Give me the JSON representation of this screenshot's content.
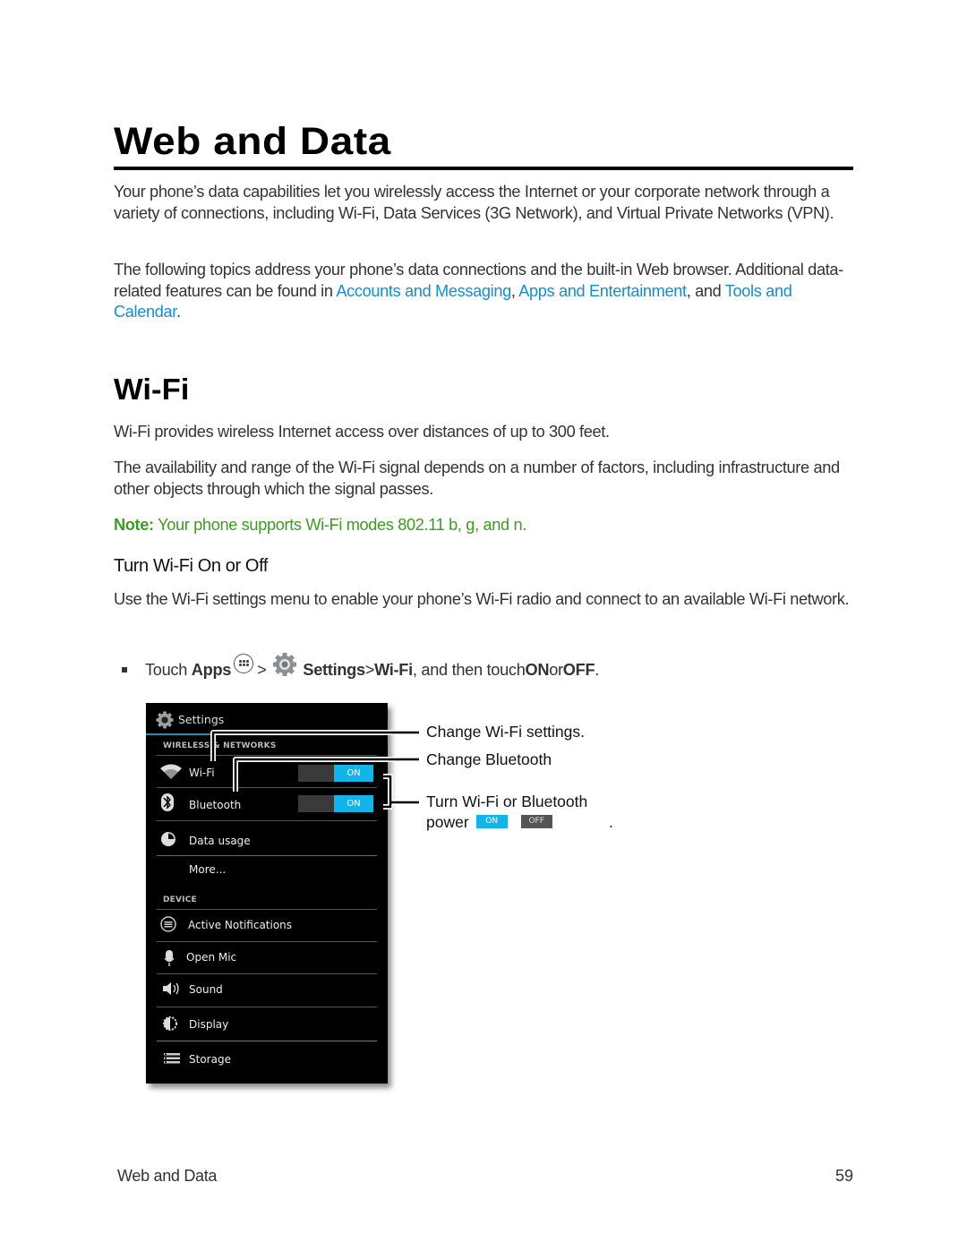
{
  "page": {
    "title": "Web and Data",
    "intro": "Your phone’s data capabilities let you wirelessly access the Internet or your corporate network through a variety of connections, including Wi-Fi, Data Services (3G Network), and Virtual Private Networks (VPN).",
    "topics": {
      "text_before": "The following topics address your phone’s data connections and the built-in Web browser. Additional data-related features can be found in ",
      "link1": "Accounts and Messaging",
      "sep1": ", ",
      "link2": "Apps and Entertainment",
      "sep2": ", and ",
      "link3": "Tools and Calendar",
      "end": "."
    }
  },
  "wifi": {
    "heading": "Wi-Fi",
    "p1": "Wi-Fi provides wireless Internet access over distances of up to 300 feet.",
    "p2": "The availability and range of the Wi-Fi signal depends on a number of factors, including infrastructure and other objects through which the signal passes.",
    "note_label": "Note:",
    "note_text": " Your phone supports Wi-Fi modes 802.11 b, g, and n.",
    "subheading": "Turn Wi-Fi On or Off",
    "p3": "Use the Wi-Fi settings menu to enable your phone’s Wi-Fi radio and connect to an available Wi-Fi network.",
    "colors": {
      "link": "#1b8cc4",
      "note": "#3d9a23",
      "toggle_on": "#12b4ea"
    }
  },
  "step": {
    "touch": "Touch ",
    "apps": "Apps",
    "gt1": " > ",
    "settings": "Settings",
    "gt2": " > ",
    "wifi": "Wi-Fi",
    "then": ", and then touch ",
    "on": "ON",
    "or": " or ",
    "off": "OFF",
    "end": "."
  },
  "phone": {
    "title": "Settings",
    "section_wireless": "WIRELESS & NETWORKS",
    "section_device": "DEVICE",
    "items": [
      {
        "label": "Wi-Fi",
        "icon": "wifi-icon",
        "toggle": "ON"
      },
      {
        "label": "Bluetooth",
        "icon": "bluetooth-icon",
        "toggle": "ON"
      },
      {
        "label": "Data usage",
        "icon": "data-usage-icon"
      },
      {
        "label": "More...",
        "icon": ""
      },
      {
        "label": "Active Notifications",
        "icon": "notifications-icon"
      },
      {
        "label": "Open Mic",
        "icon": "mic-icon"
      },
      {
        "label": "Sound",
        "icon": "speaker-icon"
      },
      {
        "label": "Display",
        "icon": "display-icon"
      },
      {
        "label": "Storage",
        "icon": "storage-icon"
      }
    ]
  },
  "callouts": {
    "wifi": "Change Wi-Fi settings.",
    "bluetooth": "Change Bluetooth",
    "power_line1": "Turn Wi-Fi  or Bluetooth",
    "power_line2": "power",
    "on": "ON",
    "off": "OFF",
    "end": "."
  },
  "footer": {
    "section": "Web and Data",
    "page_number": "59"
  }
}
